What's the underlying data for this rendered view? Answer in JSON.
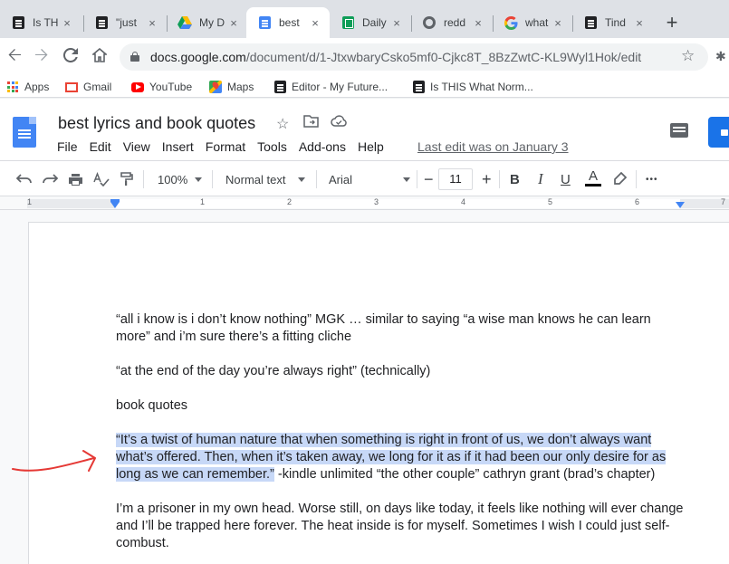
{
  "browser": {
    "tabs": [
      {
        "label": "Is TH",
        "icon": "docs-icon",
        "active": false
      },
      {
        "label": "\"just",
        "icon": "docs-icon",
        "active": false
      },
      {
        "label": "My D",
        "icon": "drive-icon",
        "active": false
      },
      {
        "label": "best",
        "icon": "docs-icon",
        "active": true
      },
      {
        "label": "Daily",
        "icon": "sheets-icon",
        "active": false
      },
      {
        "label": "redd",
        "icon": "globe-icon",
        "active": false
      },
      {
        "label": "what",
        "icon": "google-icon",
        "active": false
      },
      {
        "label": "Tind",
        "icon": "docs-icon",
        "active": false
      }
    ],
    "tab_close_glyph": "×",
    "new_tab_glyph": "+",
    "url_host": "docs.google.com",
    "url_path": "/document/d/1-JtxwbaryCsko5mf0-Cjkc8T_8BzZwtC-KL9Wyl1Hok/edit",
    "bookmarks": [
      {
        "label": "Apps",
        "icon": "apps-grid-icon"
      },
      {
        "label": "Gmail",
        "icon": "gmail-icon"
      },
      {
        "label": "YouTube",
        "icon": "youtube-icon"
      },
      {
        "label": "Maps",
        "icon": "maps-icon"
      },
      {
        "label": "Editor - My Future...",
        "icon": "docs-icon"
      },
      {
        "label": "Is THIS What Norm...",
        "icon": "docs-icon"
      }
    ]
  },
  "docs": {
    "title": "best lyrics and book quotes",
    "menu": [
      "File",
      "Edit",
      "View",
      "Insert",
      "Format",
      "Tools",
      "Add-ons",
      "Help"
    ],
    "last_edit": "Last edit was on January 3",
    "toolbar": {
      "zoom": "100%",
      "style": "Normal text",
      "font": "Arial",
      "font_size": "11",
      "minus": "−",
      "plus": "+",
      "bold": "B",
      "italic": "I",
      "underline": "U",
      "text_color": "A",
      "more": "•••"
    },
    "ruler_numbers": [
      "1",
      "1",
      "2",
      "3",
      "4",
      "5",
      "6",
      "7"
    ],
    "body": {
      "p1": "“all i know is i don’t know nothing” MGK … similar to saying “a wise man knows he can learn more” and i’m sure there’s a fitting cliche",
      "p2": "“at the end of the day you’re always right” (technically)",
      "p3": "book quotes",
      "p4_highlight": "“It’s a twist of human nature that when something is right in front of us, we don’t always want what’s offered. Then, when it’s taken away, we long for it as if it had been our only desire for as long as we can remember.”",
      "p4_rest": " -kindle unlimited “the other couple” cathryn grant (brad’s chapter)",
      "p5": "I’m a prisoner in my own head. Worse still, on days like today, it feels like nothing will ever change and I’ll be trapped here forever. The heat inside is for myself. Sometimes I wish I could just self-combust."
    }
  },
  "colors": {
    "selection": "#c7d8f7",
    "accent": "#1a73e8",
    "annotation": "#e53935"
  }
}
